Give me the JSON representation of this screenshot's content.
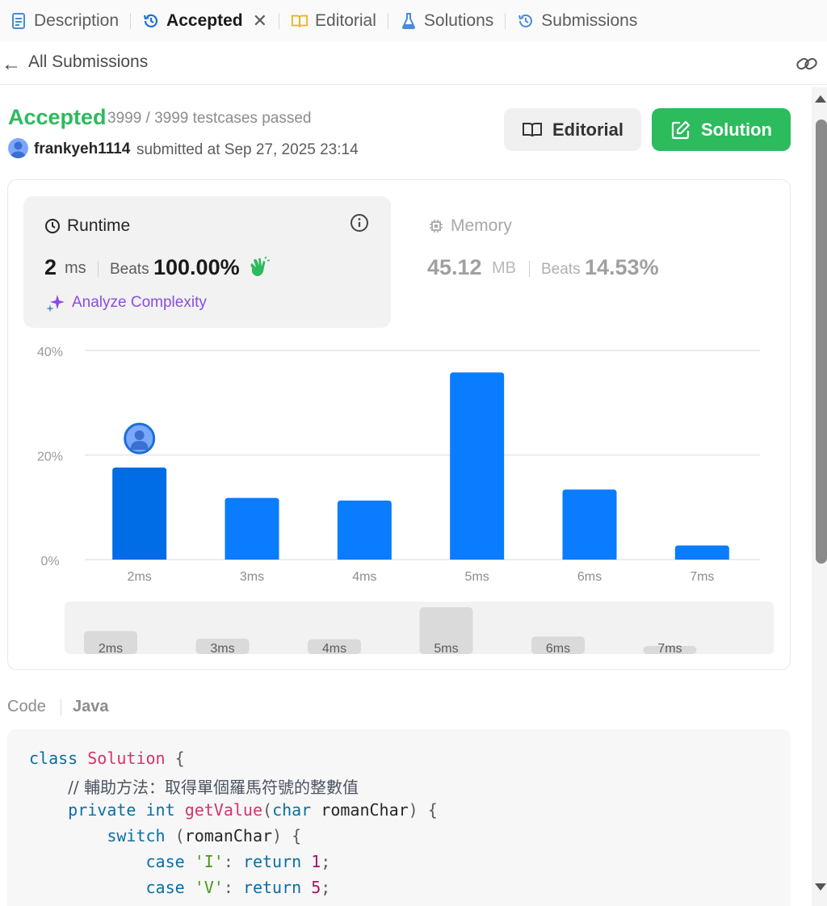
{
  "tabs": [
    {
      "label": "Description",
      "icon": "description-icon",
      "active": false
    },
    {
      "label": "Accepted",
      "icon": "history-icon",
      "active": true
    },
    {
      "label": "Editorial",
      "icon": "book-icon",
      "active": false
    },
    {
      "label": "Solutions",
      "icon": "flask-icon",
      "active": false
    },
    {
      "label": "Submissions",
      "icon": "history-icon",
      "active": false
    }
  ],
  "back": {
    "label": "All Submissions"
  },
  "submission": {
    "status": "Accepted",
    "testcases": "3999 / 3999 testcases passed",
    "username": "frankyeh1114",
    "submitted": "submitted at Sep 27, 2025 23:14"
  },
  "buttons": {
    "editorial": "Editorial",
    "solution": "Solution"
  },
  "runtime": {
    "title": "Runtime",
    "value": "2",
    "unit": "ms",
    "beats_label": "Beats",
    "beats_value": "100.00%",
    "analyze": "Analyze Complexity"
  },
  "memory": {
    "title": "Memory",
    "value": "45.12",
    "unit": "MB",
    "beats_label": "Beats",
    "beats_value": "14.53%"
  },
  "colors": {
    "accent": "#2cbb5d",
    "bar": "#0a7cff",
    "bar_selected": "#006ce6",
    "analyze": "#8a4dde"
  },
  "chart_data": {
    "type": "bar",
    "categories": [
      "2ms",
      "3ms",
      "4ms",
      "5ms",
      "6ms",
      "7ms"
    ],
    "values": [
      17.6,
      11.8,
      11.3,
      35.8,
      13.4,
      2.7
    ],
    "ylim": [
      0,
      40
    ],
    "yticks": [
      "0%",
      "20%",
      "40%"
    ],
    "selected": "2ms",
    "grid": true
  },
  "mini_chart": {
    "categories": [
      "2ms",
      "3ms",
      "4ms",
      "5ms",
      "6ms",
      "7ms"
    ]
  },
  "code": {
    "label": "Code",
    "language": "Java",
    "lines": [
      "class Solution {",
      "    // 輔助方法：取得單個羅馬符號的整數值",
      "    private int getValue(char romanChar) {",
      "        switch (romanChar) {",
      "            case 'I': return 1;",
      "            case 'V': return 5;"
    ]
  }
}
